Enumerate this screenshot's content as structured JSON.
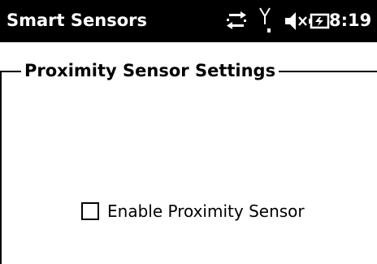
{
  "status_bar": {
    "app_title": "Smart Sensors",
    "time": "8:19",
    "icons": [
      "data-sync-icon",
      "signal-icon",
      "speaker-muted-icon",
      "battery-charging-icon"
    ]
  },
  "settings": {
    "group_title": "Proximity Sensor Settings",
    "proximity_checkbox": {
      "label": "Enable Proximity Sensor",
      "checked": false
    }
  },
  "colors": {
    "status_bar_bg": "#000000",
    "status_bar_fg": "#ffffff",
    "content_bg": "#ffffff"
  }
}
